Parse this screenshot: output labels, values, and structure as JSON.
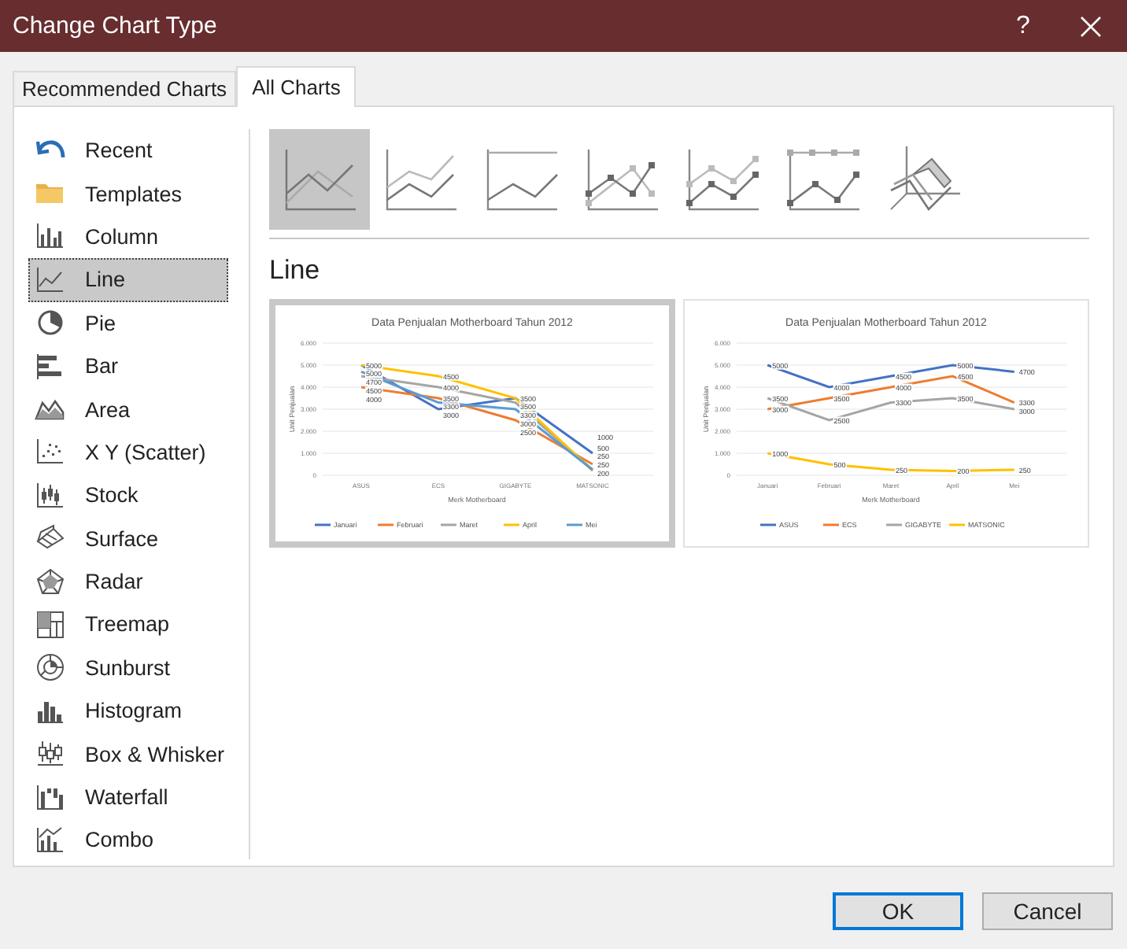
{
  "window": {
    "title": "Change Chart Type",
    "help_label": "?"
  },
  "tabs": [
    {
      "label": "Recommended Charts",
      "selected": false
    },
    {
      "label": "All Charts",
      "selected": true
    }
  ],
  "sidebar": {
    "items": [
      {
        "label": "Recent",
        "selected": false
      },
      {
        "label": "Templates",
        "selected": false
      },
      {
        "label": "Column",
        "selected": false
      },
      {
        "label": "Line",
        "selected": true
      },
      {
        "label": "Pie",
        "selected": false
      },
      {
        "label": "Bar",
        "selected": false
      },
      {
        "label": "Area",
        "selected": false
      },
      {
        "label": "X Y (Scatter)",
        "selected": false
      },
      {
        "label": "Stock",
        "selected": false
      },
      {
        "label": "Surface",
        "selected": false
      },
      {
        "label": "Radar",
        "selected": false
      },
      {
        "label": "Treemap",
        "selected": false
      },
      {
        "label": "Sunburst",
        "selected": false
      },
      {
        "label": "Histogram",
        "selected": false
      },
      {
        "label": "Box & Whisker",
        "selected": false
      },
      {
        "label": "Waterfall",
        "selected": false
      },
      {
        "label": "Combo",
        "selected": false
      }
    ]
  },
  "subtypes": [
    {
      "selected": true
    },
    {
      "selected": false
    },
    {
      "selected": false
    },
    {
      "selected": false
    },
    {
      "selected": false
    },
    {
      "selected": false
    },
    {
      "selected": false
    }
  ],
  "heading": "Line",
  "previews": [
    {
      "selected": true,
      "chart_data": {
        "type": "line",
        "grid": true,
        "legend": true,
        "title": "Data Penjualan Motherboard Tahun 2012",
        "xlabel": "Merk Motherboard",
        "ylabel": "Unit Penjualan",
        "categories": [
          "ASUS",
          "ECS",
          "GIGABYTE",
          "MATSONIC"
        ],
        "ylim": [
          0,
          6000
        ],
        "yticks": [
          {
            "value": 0,
            "label": "0"
          },
          {
            "value": 1000,
            "label": "1.000"
          },
          {
            "value": 2000,
            "label": "2.000"
          },
          {
            "value": 3000,
            "label": "3.000"
          },
          {
            "value": 4000,
            "label": "4.000"
          },
          {
            "value": 5000,
            "label": "5.000"
          },
          {
            "value": 6000,
            "label": "6.000"
          }
        ],
        "data_labels": true,
        "series": [
          {
            "name": "Januari",
            "color": "#4472c4",
            "values": [
              5000,
              3000,
              3500,
              1000
            ]
          },
          {
            "name": "Februari",
            "color": "#ed7d31",
            "values": [
              4000,
              3500,
              2500,
              500
            ]
          },
          {
            "name": "Maret",
            "color": "#a5a5a5",
            "values": [
              4500,
              4000,
              3300,
              250
            ]
          },
          {
            "name": "April",
            "color": "#ffc000",
            "values": [
              5000,
              4500,
              3500,
              200
            ]
          },
          {
            "name": "Mei",
            "color": "#5b9bd5",
            "values": [
              4700,
              3300,
              3000,
              250
            ]
          }
        ]
      }
    },
    {
      "selected": false,
      "chart_data": {
        "type": "line",
        "grid": true,
        "legend": true,
        "title": "Data Penjualan Motherboard Tahun 2012",
        "xlabel": "Merk Motherboard",
        "ylabel": "Unit Penjualan",
        "categories": [
          "Januari",
          "Februari",
          "Maret",
          "April",
          "Mei"
        ],
        "ylim": [
          0,
          6000
        ],
        "yticks": [
          {
            "value": 0,
            "label": "0"
          },
          {
            "value": 1000,
            "label": "1.000"
          },
          {
            "value": 2000,
            "label": "2.000"
          },
          {
            "value": 3000,
            "label": "3.000"
          },
          {
            "value": 4000,
            "label": "4.000"
          },
          {
            "value": 5000,
            "label": "5.000"
          },
          {
            "value": 6000,
            "label": "6.000"
          }
        ],
        "data_labels": true,
        "series": [
          {
            "name": "ASUS",
            "color": "#4472c4",
            "values": [
              5000,
              4000,
              4500,
              5000,
              4700
            ]
          },
          {
            "name": "ECS",
            "color": "#ed7d31",
            "values": [
              3000,
              3500,
              4000,
              4500,
              3300
            ]
          },
          {
            "name": "GIGABYTE",
            "color": "#a5a5a5",
            "values": [
              3500,
              2500,
              3300,
              3500,
              3000
            ]
          },
          {
            "name": "MATSONIC",
            "color": "#ffc000",
            "values": [
              1000,
              500,
              250,
              200,
              250
            ]
          }
        ]
      }
    }
  ],
  "buttons": [
    {
      "label": "OK",
      "default": true
    },
    {
      "label": "Cancel",
      "default": false
    }
  ]
}
